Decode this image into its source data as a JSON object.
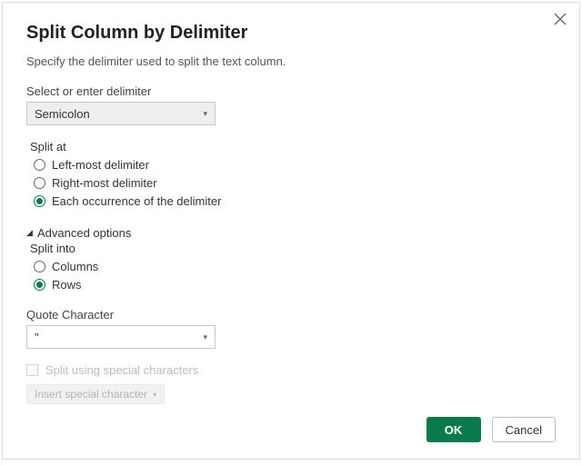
{
  "dialog": {
    "title": "Split Column by Delimiter",
    "subtitle": "Specify the delimiter used to split the text column."
  },
  "delimiter": {
    "label": "Select or enter delimiter",
    "value": "Semicolon"
  },
  "split_at": {
    "label": "Split at",
    "options": [
      {
        "label": "Left-most delimiter",
        "selected": false
      },
      {
        "label": "Right-most delimiter",
        "selected": false
      },
      {
        "label": "Each occurrence of the delimiter",
        "selected": true
      }
    ]
  },
  "advanced": {
    "label": "Advanced options",
    "split_into_label": "Split into",
    "split_into": [
      {
        "label": "Columns",
        "selected": false
      },
      {
        "label": "Rows",
        "selected": true
      }
    ]
  },
  "quote": {
    "label": "Quote Character",
    "value": "\""
  },
  "special": {
    "checkbox_label": "Split using special characters",
    "button_label": "Insert special character"
  },
  "buttons": {
    "ok": "OK",
    "cancel": "Cancel"
  }
}
